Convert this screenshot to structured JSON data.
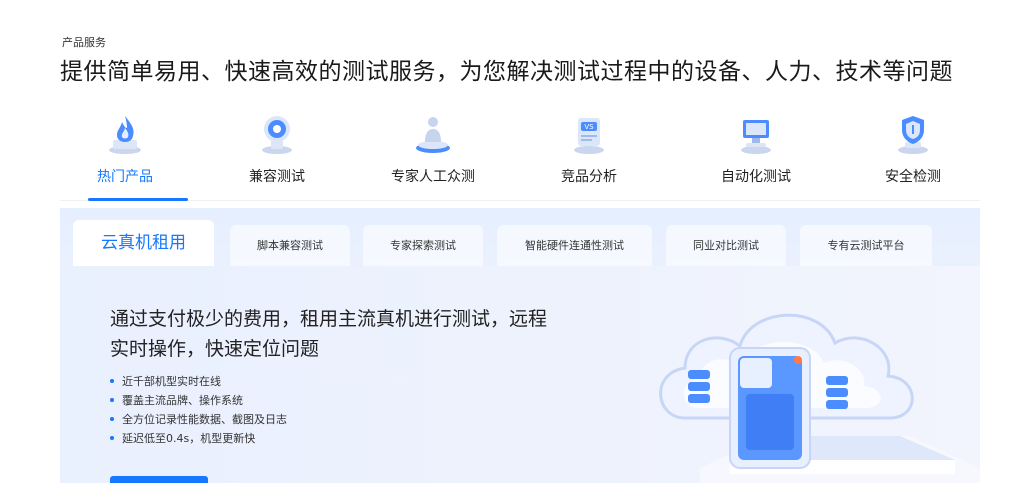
{
  "eyebrow": "产品服务",
  "headline": "提供简单易用、快速高效的测试服务，为您解决测试过程中的设备、人力、技术等问题",
  "categories": [
    {
      "label": "热门产品",
      "icon": "fire-trophy-icon"
    },
    {
      "label": "兼容测试",
      "icon": "webcam-icon"
    },
    {
      "label": "专家人工众测",
      "icon": "expert-person-icon"
    },
    {
      "label": "竞品分析",
      "icon": "vs-document-icon"
    },
    {
      "label": "自动化测试",
      "icon": "robot-computer-icon"
    },
    {
      "label": "安全检测",
      "icon": "shield-icon"
    }
  ],
  "active_category": "热门产品",
  "tabs": [
    "云真机租用",
    "脚本兼容测试",
    "专家探索测试",
    "智能硬件连通性测试",
    "同业对比测试",
    "专有云测试平台"
  ],
  "active_tab": "云真机租用",
  "panel": {
    "title": "通过支付极少的费用，租用主流真机进行测试，远程实时操作，快速定位问题",
    "bullets": [
      "近千部机型实时在线",
      "覆盖主流品牌、操作系统",
      "全方位记录性能数据、截图及日志",
      "延迟低至0.4s，机型更新快"
    ]
  },
  "colors": {
    "accent": "#1677ff",
    "panel_bg": "#eaf0fe"
  }
}
